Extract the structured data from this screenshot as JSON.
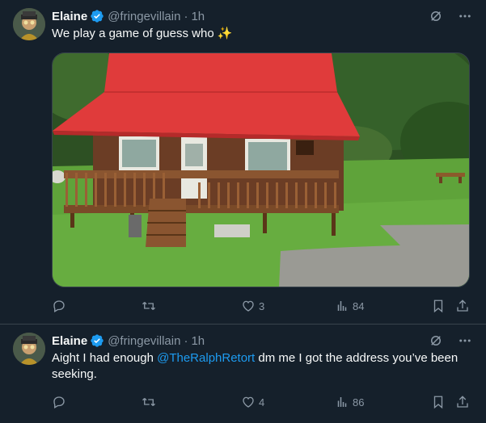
{
  "tweets": [
    {
      "name": "Elaine",
      "handle": "@fringevillain",
      "separator": "·",
      "time": "1h",
      "text": "We play a game of guess who ✨",
      "actions": {
        "reply": "",
        "retweet": "",
        "like": "3",
        "views": "84"
      },
      "media": {
        "description": "red-roof-cabin-photo"
      }
    },
    {
      "name": "Elaine",
      "handle": "@fringevillain",
      "separator": "·",
      "time": "1h",
      "text_before": "Aight I had enough ",
      "mention": "@TheRalphRetort",
      "text_after": " dm me I got the address you’ve been seeking.",
      "actions": {
        "reply": "",
        "retweet": "",
        "like": "4",
        "views": "86"
      }
    }
  ],
  "colors": {
    "background": "#15202b",
    "accent": "#1d9bf0",
    "muted": "#8b98a5",
    "roof": "#e03b3b",
    "grass": "#5fa33a"
  }
}
